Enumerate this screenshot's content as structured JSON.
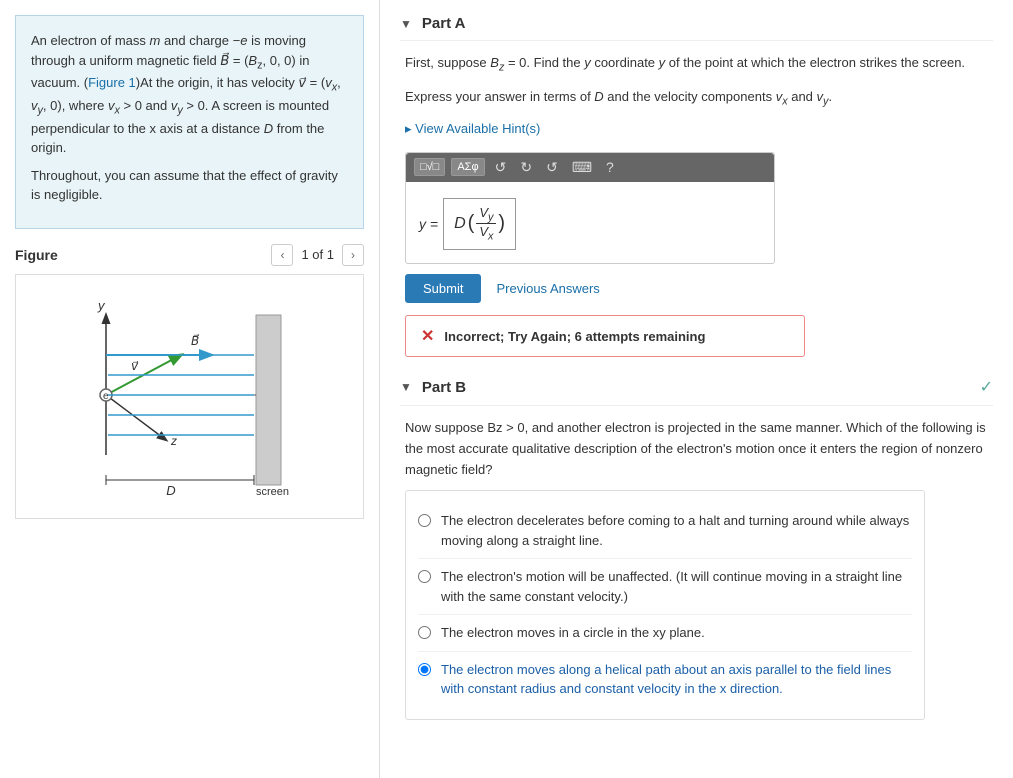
{
  "left": {
    "problem": {
      "line1": "An electron of mass ",
      "m": "m",
      "line2": " and charge ",
      "neg_e": "−e",
      "line3": " is moving through a uniform magnetic field ",
      "B_vec": "B⃗",
      "B_eq": " = (Bz, 0, 0) in vacuum. (Figure 1)At the origin, it has velocity ",
      "v_vec": "v⃗",
      "v_eq": " = (vx, vy, 0), where ",
      "vx_cond": "vx > 0",
      "and": " and ",
      "vy_cond": "vy > 0",
      "rest": ". A screen is mounted perpendicular to the x axis at a distance D from the origin.",
      "gravity": "Throughout, you can assume that the effect of gravity is negligible."
    },
    "figure": {
      "title": "Figure",
      "page": "1 of 1"
    }
  },
  "right": {
    "partA": {
      "title": "Part A",
      "question": "First, suppose Bz = 0. Find the y coordinate y of the point at which the electron strikes the screen.",
      "express": "Express your answer in terms of D and the velocity components vx and vy.",
      "hints_link": "▸ View Available Hint(s)",
      "formula_y": "y =",
      "formula_D": "D",
      "formula_Vy": "V",
      "formula_Vy_sub": "y",
      "formula_Vx": "V",
      "formula_Vx_sub": "x",
      "submit_label": "Submit",
      "prev_answers": "Previous Answers",
      "error_text": "Incorrect; Try Again; 6 attempts remaining"
    },
    "partB": {
      "title": "Part B",
      "check": "✓",
      "question": "Now suppose Bz > 0, and another electron is projected in the same manner. Which of the following is the most accurate qualitative description of the electron's motion once it enters the region of nonzero magnetic field?",
      "options": [
        {
          "id": "opt1",
          "text": "The electron decelerates before coming to a halt and turning around while always moving along a straight line.",
          "selected": false
        },
        {
          "id": "opt2",
          "text": "The electron's motion will be unaffected. (It will continue moving in a straight line with the same constant velocity.)",
          "selected": false
        },
        {
          "id": "opt3",
          "text": "The electron moves in a circle in the xy plane.",
          "selected": false
        },
        {
          "id": "opt4",
          "text": "The electron moves along a helical path about an axis parallel to the field lines with constant radius and constant velocity in the x direction.",
          "selected": true
        }
      ]
    },
    "toolbar": {
      "btn1": "□√□",
      "btn2": "ΑΣφ"
    }
  }
}
